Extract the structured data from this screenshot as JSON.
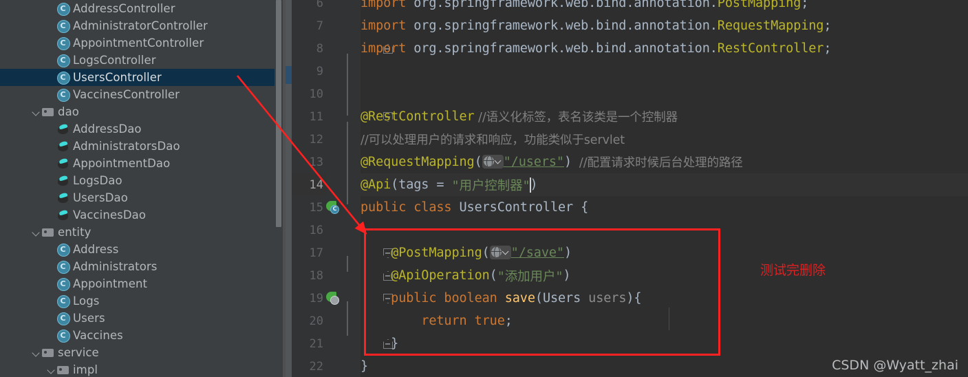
{
  "sidebar": {
    "scrollbar": {
      "name": "project-tree-scrollbar"
    },
    "items": [
      {
        "label": "AddressController",
        "icon": "class-icon",
        "indent": 4,
        "arrow": "none",
        "selected": false
      },
      {
        "label": "AdministratorController",
        "icon": "class-icon",
        "indent": 4,
        "arrow": "none",
        "selected": false
      },
      {
        "label": "AppointmentController",
        "icon": "class-icon",
        "indent": 4,
        "arrow": "none",
        "selected": false
      },
      {
        "label": "LogsController",
        "icon": "class-icon",
        "indent": 4,
        "arrow": "none",
        "selected": false
      },
      {
        "label": "UsersController",
        "icon": "class-icon",
        "indent": 4,
        "arrow": "none",
        "selected": true
      },
      {
        "label": "VaccinesController",
        "icon": "class-icon",
        "indent": 4,
        "arrow": "none",
        "selected": false
      },
      {
        "label": "dao",
        "icon": "folder-icon",
        "indent": 3,
        "arrow": "open",
        "selected": false
      },
      {
        "label": "AddressDao",
        "icon": "interface-icon",
        "indent": 4,
        "arrow": "none",
        "selected": false
      },
      {
        "label": "AdministratorsDao",
        "icon": "interface-icon",
        "indent": 4,
        "arrow": "none",
        "selected": false
      },
      {
        "label": "AppointmentDao",
        "icon": "interface-icon",
        "indent": 4,
        "arrow": "none",
        "selected": false
      },
      {
        "label": "LogsDao",
        "icon": "interface-icon",
        "indent": 4,
        "arrow": "none",
        "selected": false
      },
      {
        "label": "UsersDao",
        "icon": "interface-icon",
        "indent": 4,
        "arrow": "none",
        "selected": false
      },
      {
        "label": "VaccinesDao",
        "icon": "interface-icon",
        "indent": 4,
        "arrow": "none",
        "selected": false
      },
      {
        "label": "entity",
        "icon": "folder-icon",
        "indent": 3,
        "arrow": "open",
        "selected": false
      },
      {
        "label": "Address",
        "icon": "class-icon",
        "indent": 4,
        "arrow": "none",
        "selected": false
      },
      {
        "label": "Administrators",
        "icon": "class-icon",
        "indent": 4,
        "arrow": "none",
        "selected": false
      },
      {
        "label": "Appointment",
        "icon": "class-icon",
        "indent": 4,
        "arrow": "none",
        "selected": false
      },
      {
        "label": "Logs",
        "icon": "class-icon",
        "indent": 4,
        "arrow": "none",
        "selected": false
      },
      {
        "label": "Users",
        "icon": "class-icon",
        "indent": 4,
        "arrow": "none",
        "selected": false
      },
      {
        "label": "Vaccines",
        "icon": "class-icon",
        "indent": 4,
        "arrow": "none",
        "selected": false
      },
      {
        "label": "service",
        "icon": "folder-icon",
        "indent": 3,
        "arrow": "open",
        "selected": false
      },
      {
        "label": "impl",
        "icon": "folder-icon",
        "indent": 4,
        "arrow": "open",
        "selected": false
      }
    ]
  },
  "editor": {
    "line_numbers": [
      "6",
      "7",
      "8",
      "9",
      "10",
      "11",
      "12",
      "13",
      "14",
      "15",
      "16",
      "17",
      "18",
      "19",
      "20",
      "21",
      "22"
    ],
    "lines": {
      "l6": {
        "num": "6",
        "import_kw": "import",
        "pkg": " org.springframework.web.bind.annotation.",
        "cls": "PostMapping",
        "semi": ";"
      },
      "l7": {
        "num": "7",
        "import_kw": "import",
        "pkg": " org.springframework.web.bind.annotation.",
        "cls": "RequestMapping",
        "semi": ";"
      },
      "l8": {
        "num": "8",
        "import_kw": "import",
        "pkg": " org.springframework.web.bind.annotation.",
        "cls": "RestController",
        "semi": ";"
      },
      "l9": {
        "num": "9",
        "text": ""
      },
      "l10": {
        "num": "10",
        "text": ""
      },
      "l11": {
        "num": "11",
        "ann": "@RestController",
        "comment": "//语义化标签，表名该类是一个控制器"
      },
      "l12": {
        "num": "12",
        "comment": "//可以处理用户的请求和响应，功能类似于servlet"
      },
      "l13": {
        "num": "13",
        "ann": "@RequestMapping",
        "open": "(",
        "badge": "globe-dropdown-icon",
        "path": "\"/users\"",
        "close": ")",
        "comment": "//配置请求时候后台处理的路径"
      },
      "l14": {
        "num": "14",
        "ann": "@Api",
        "rest": "(tags = ",
        "value": "\"用户控制器\"",
        "close": ")",
        "caret": true
      },
      "l15": {
        "num": "15",
        "kw1": "public",
        "kw2": "class",
        "cls": "UsersController",
        "brace": "{",
        "gutter_icon": "spring-bean-icon"
      },
      "l16": {
        "num": "16",
        "text": ""
      },
      "l17": {
        "num": "17",
        "ann": "@PostMapping",
        "open": "(",
        "badge": "globe-dropdown-icon",
        "path": "\"/save\"",
        "close": ")"
      },
      "l18": {
        "num": "18",
        "ann": "@ApiOperation",
        "open": "(",
        "value": "\"添加用户\"",
        "close": ")"
      },
      "l19": {
        "num": "19",
        "kw1": "public",
        "kw2": "boolean",
        "meth": "save",
        "open": "(",
        "type": "Users",
        "param": " users",
        "close": ")",
        "brace": "{",
        "gutter_icon": "spring-endpoint-icon"
      },
      "l20": {
        "num": "20",
        "ret": "return",
        "val": " true",
        "semi": ";"
      },
      "l21": {
        "num": "21",
        "brace": "}"
      },
      "l22": {
        "num": "22",
        "brace": "}"
      }
    }
  },
  "annotations": {
    "red_note": "测试完删除",
    "red_box_color": "#ff2222",
    "arrow_color": "#ff2020"
  },
  "watermark": "CSDN @Wyatt_zhai"
}
